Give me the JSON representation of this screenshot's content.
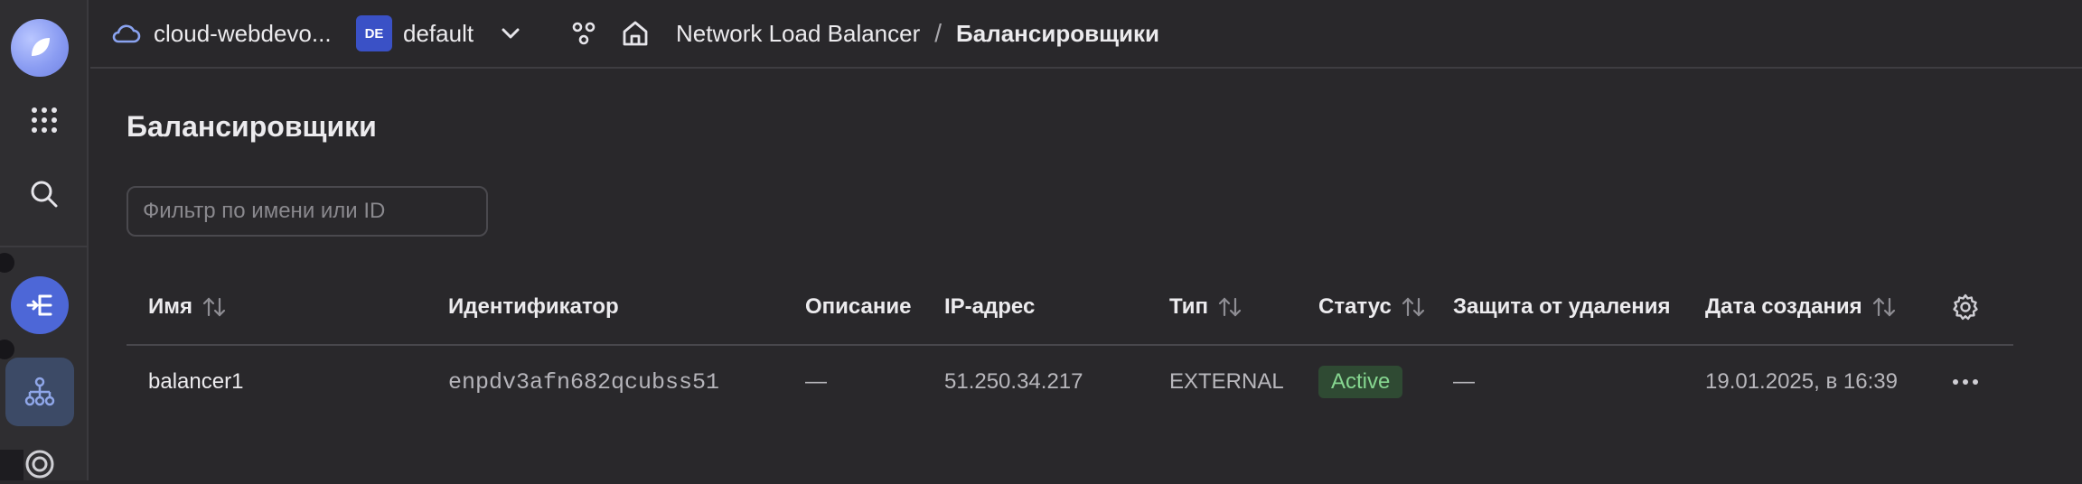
{
  "topbar": {
    "cloud_name": "cloud-webdevo...",
    "folder_badge": "DE",
    "folder_name": "default",
    "service": "Network Load Balancer",
    "separator": "/",
    "current": "Балансировщики"
  },
  "page": {
    "title": "Балансировщики",
    "filter_placeholder": "Фильтр по имени или ID",
    "filter_value": ""
  },
  "table": {
    "columns": [
      "Имя",
      "Идентификатор",
      "Описание",
      "IP-адрес",
      "Тип",
      "Статус",
      "Защита от удаления",
      "Дата создания"
    ],
    "rows": [
      {
        "name": "balancer1",
        "id": "enpdv3afn682qcubss51",
        "description": "—",
        "ip": "51.250.34.217",
        "type": "EXTERNAL",
        "status": "Active",
        "deletion_protection": "—",
        "created": "19.01.2025, в 16:39"
      }
    ]
  },
  "colors": {
    "background": "#29282b",
    "accent": "#4d67d7",
    "status_active_bg": "#2f4a33",
    "status_active_text": "#86d690"
  }
}
